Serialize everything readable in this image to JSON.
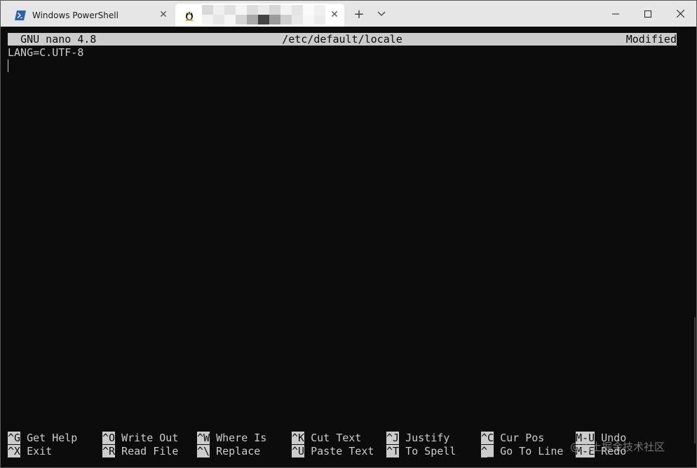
{
  "window": {
    "tabs": [
      {
        "label": "Windows PowerShell",
        "icon": "powershell-icon"
      },
      {
        "label": "",
        "icon": "linux-penguin-icon",
        "title_obscured": true
      }
    ],
    "new_tab_symbol": "+",
    "dropdown_symbol": "⌄"
  },
  "nano": {
    "version": "GNU nano 4.8",
    "filename": "/etc/default/locale",
    "status": "Modified",
    "lines": [
      "LANG=C.UTF-8"
    ],
    "shortcuts_row1": [
      {
        "key": "^G",
        "label": "Get Help"
      },
      {
        "key": "^O",
        "label": "Write Out"
      },
      {
        "key": "^W",
        "label": "Where Is"
      },
      {
        "key": "^K",
        "label": "Cut Text"
      },
      {
        "key": "^J",
        "label": "Justify"
      },
      {
        "key": "^C",
        "label": "Cur Pos"
      },
      {
        "key": "M-U",
        "label": "Undo"
      }
    ],
    "shortcuts_row2": [
      {
        "key": "^X",
        "label": "Exit"
      },
      {
        "key": "^R",
        "label": "Read File"
      },
      {
        "key": "^\\",
        "label": "Replace"
      },
      {
        "key": "^U",
        "label": "Paste Text"
      },
      {
        "key": "^T",
        "label": "To Spell"
      },
      {
        "key": "^_",
        "label": "Go To Line"
      },
      {
        "key": "M-E",
        "label": "Redo"
      }
    ]
  },
  "watermark": "@稀土掘金技术社区",
  "colors": {
    "terminal_bg": "#0c0c0c",
    "terminal_fg": "#cccccc",
    "tabbar_bg": "#e6e6e6",
    "active_tab_bg": "#ffffff",
    "powershell_blue": "#2b5fb3"
  }
}
